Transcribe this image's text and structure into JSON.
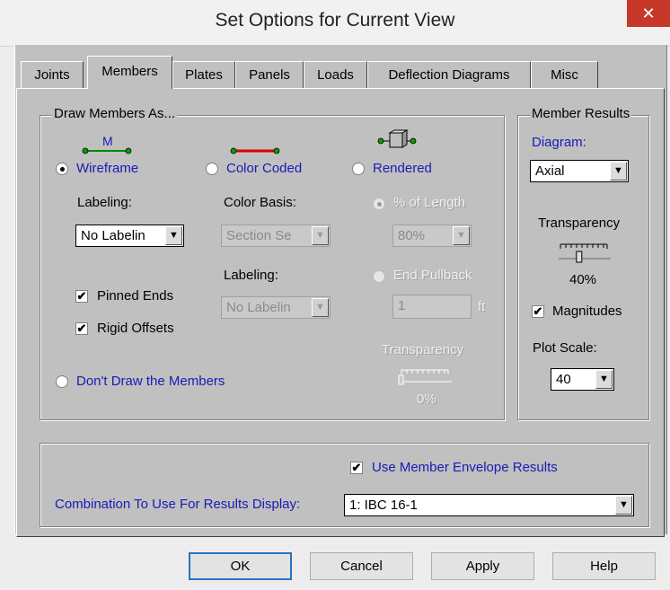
{
  "window": {
    "title": "Set Options for Current View",
    "close_glyph": "✕"
  },
  "tabs": [
    {
      "label": "Joints"
    },
    {
      "label": "Members"
    },
    {
      "label": "Plates"
    },
    {
      "label": "Panels"
    },
    {
      "label": "Loads"
    },
    {
      "label": "Deflection Diagrams"
    },
    {
      "label": "Misc"
    }
  ],
  "draw_members": {
    "group_label": "Draw Members As...",
    "wireframe": {
      "icon_label": "M",
      "label": "Wireframe",
      "labeling_label": "Labeling:",
      "labeling_value": "No Labelin"
    },
    "color_coded": {
      "label": "Color Coded",
      "basis_label": "Color Basis:",
      "basis_value": "Section Se",
      "labeling_label": "Labeling:",
      "labeling_value": "No Labelin"
    },
    "rendered": {
      "label": "Rendered",
      "pct_length_label": "% of Length",
      "pct_length_value": "80%",
      "end_pullback_label": "End Pullback",
      "end_pullback_value": "1",
      "unit": "ft",
      "transparency_label": "Transparency",
      "transparency_value": "0%",
      "transparency_level": 0
    },
    "pinned_ends": "Pinned Ends",
    "rigid_offsets": "Rigid Offsets",
    "dont_draw": "Don't Draw the Members",
    "check_glyph": "✔"
  },
  "member_results": {
    "group_label": "Member Results",
    "diagram_label": "Diagram:",
    "diagram_value": "Axial",
    "transparency_label": "Transparency",
    "transparency_value": "40%",
    "transparency_level": 0.4,
    "magnitudes": "Magnitudes",
    "plot_scale_label": "Plot Scale:",
    "plot_scale_value": "40"
  },
  "envelope": {
    "use_envelope": "Use Member Envelope Results",
    "combo_label": "Combination To Use For Results Display:",
    "combo_value": "1: IBC 16-1"
  },
  "buttons": {
    "ok": "OK",
    "cancel": "Cancel",
    "apply": "Apply",
    "help": "Help"
  },
  "arrow_glyph": "▼",
  "colors": {
    "accent_blue": "#1a1ab8",
    "member_red": "#e00000",
    "member_green": "#00a000",
    "close_red": "#c7382b"
  }
}
